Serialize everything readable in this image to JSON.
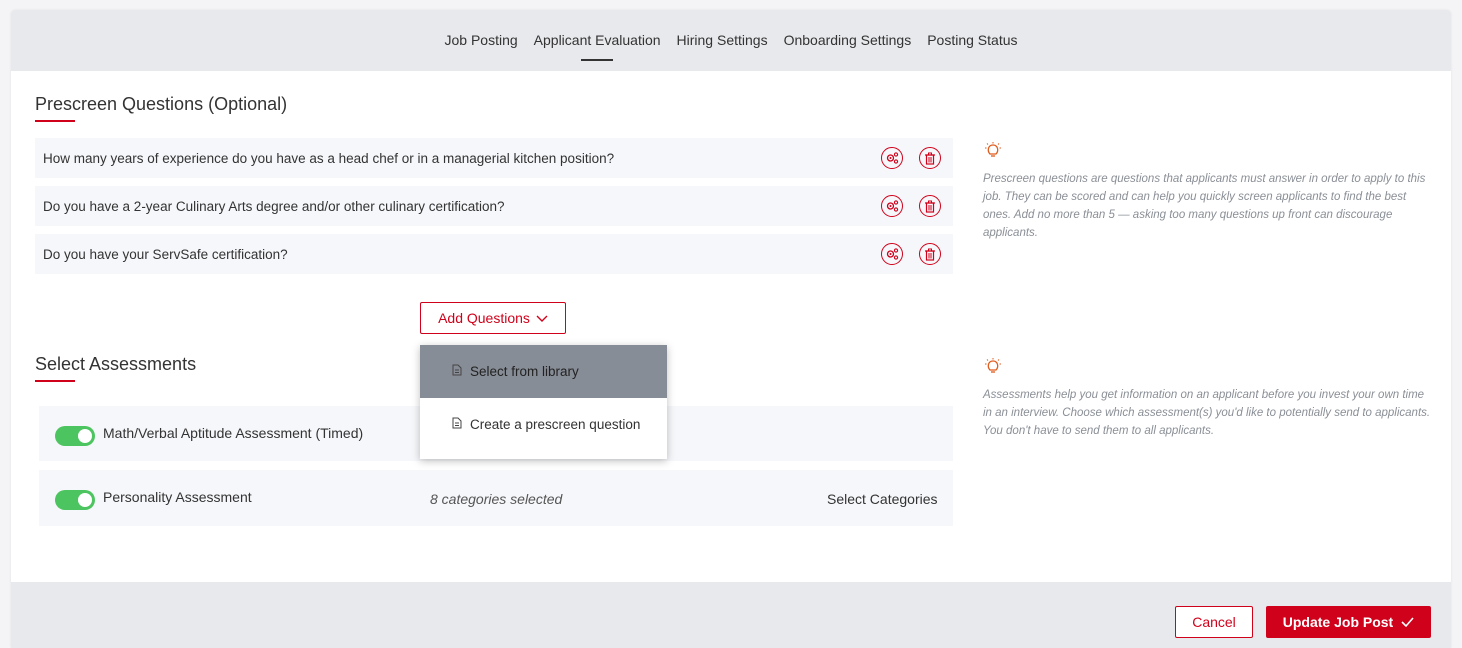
{
  "colors": {
    "accent": "#d0021b",
    "toggle_on": "#4cc45f",
    "header_bg": "#e8e9ec",
    "row_bg": "#f6f7fa"
  },
  "tabs": [
    {
      "label": "Job Posting",
      "active": false
    },
    {
      "label": "Applicant Evaluation",
      "active": true
    },
    {
      "label": "Hiring Settings",
      "active": false
    },
    {
      "label": "Onboarding Settings",
      "active": false
    },
    {
      "label": "Posting Status",
      "active": false
    }
  ],
  "prescreen": {
    "title": "Prescreen Questions (Optional)",
    "questions": [
      {
        "text": "How many years of experience do you have as a head chef or in a managerial kitchen position?",
        "settings_icon": "gear-settings-icon",
        "delete_icon": "trash-icon"
      },
      {
        "text": "Do you have a 2-year Culinary Arts degree and/or other culinary certification?",
        "settings_icon": "gear-settings-icon",
        "delete_icon": "trash-icon"
      },
      {
        "text": "Do you have your ServSafe certification?",
        "settings_icon": "gear-settings-icon",
        "delete_icon": "trash-icon"
      }
    ],
    "tip": "Prescreen questions are questions that applicants must answer in order to apply to this job. They can be scored and can help you quickly screen applicants to find the best ones. Add no more than 5 — asking too many questions up front can discourage applicants.",
    "tip_icon": "lightbulb-icon",
    "add_button": "Add Questions"
  },
  "dropdown": {
    "items": [
      {
        "label": "Select from library",
        "icon": "document-icon",
        "highlighted": true
      },
      {
        "label": "Create a prescreen question",
        "icon": "document-icon",
        "highlighted": false
      }
    ]
  },
  "assessments": {
    "title": "Select Assessments",
    "tip": "Assessments help you get information on an applicant before you invest your own time in an interview. Choose which assessment(s) you'd like to potentially send to applicants. You don't have to send them to all applicants.",
    "tip_icon": "lightbulb-icon",
    "items": [
      {
        "label": "Math/Verbal Aptitude Assessment (Timed)",
        "enabled": true
      },
      {
        "label": "Personality Assessment",
        "enabled": true,
        "status": "8 categories selected",
        "action": "Select Categories"
      }
    ]
  },
  "footer": {
    "cancel": "Cancel",
    "update": "Update Job Post"
  }
}
